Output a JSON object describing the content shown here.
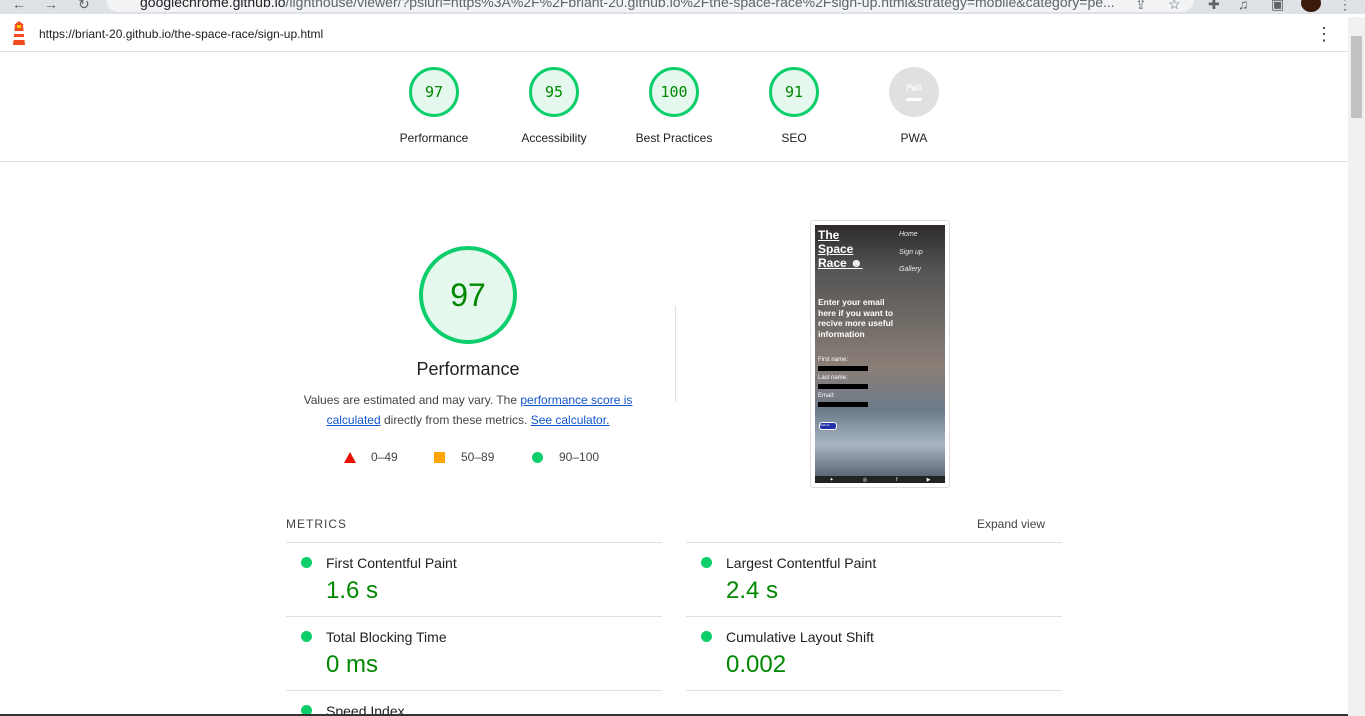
{
  "browser": {
    "address_host": "googlechrome.github.io",
    "address_path": "/lighthouse/viewer/?psiurl=https%3A%2F%2Fbriant-20.github.io%2Fthe-space-race%2Fsign-up.html&strategy=mobile&category=pe..."
  },
  "report": {
    "url": "https://briant-20.github.io/the-space-race/sign-up.html"
  },
  "scores": [
    {
      "value": "97",
      "label": "Performance"
    },
    {
      "value": "95",
      "label": "Accessibility"
    },
    {
      "value": "100",
      "label": "Best Practices"
    },
    {
      "value": "91",
      "label": "SEO"
    },
    {
      "value": "PWA",
      "label": "PWA"
    }
  ],
  "performance": {
    "score": "97",
    "title": "Performance",
    "desc_before": "Values are estimated and may vary. The ",
    "desc_link": "performance score is calculated",
    "desc_middle": " directly from these metrics. ",
    "desc_calc_link": "See calculator.",
    "legend": {
      "fail": "0–49",
      "average": "50–89",
      "pass": "90–100"
    }
  },
  "screenshot": {
    "title_lines": [
      "The",
      "Space",
      "Race"
    ],
    "nav": [
      "Home",
      "Sign up",
      "Gallery"
    ],
    "heading": "Enter your email here if you want to recive more useful information",
    "labels": [
      "First name:",
      "Last name:",
      "Email:"
    ],
    "button": "Submit"
  },
  "metrics": {
    "header": "METRICS",
    "expand": "Expand view",
    "items": [
      {
        "name": "First Contentful Paint",
        "value": "1.6 s"
      },
      {
        "name": "Largest Contentful Paint",
        "value": "2.4 s"
      },
      {
        "name": "Total Blocking Time",
        "value": "0 ms"
      },
      {
        "name": "Cumulative Layout Shift",
        "value": "0.002"
      },
      {
        "name": "Speed Index",
        "value": ""
      }
    ]
  },
  "colors": {
    "pass": "#0cce6b",
    "average": "#ffa400",
    "fail": "#eb0f00",
    "pass_text": "#008800",
    "link": "#1155cc"
  }
}
